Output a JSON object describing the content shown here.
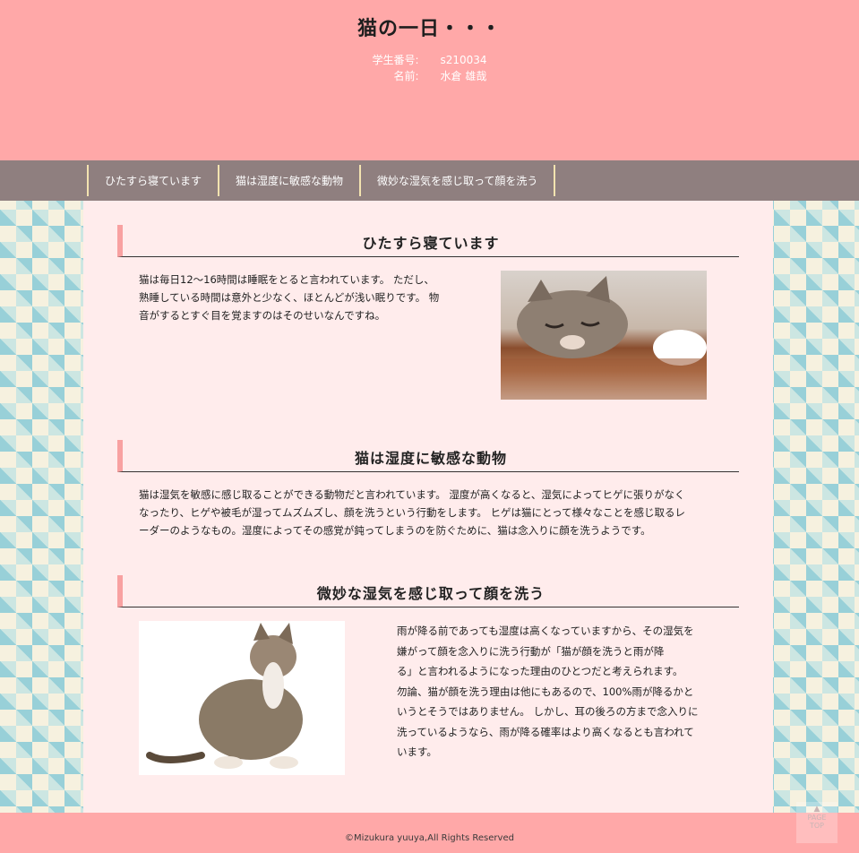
{
  "header": {
    "title": "猫の一日・・・",
    "student_id_label": "学生番号:",
    "student_id": "s210034",
    "name_label": "名前:",
    "name": "水倉 雄哉"
  },
  "nav": {
    "items": [
      {
        "label": "ひたすら寝ています"
      },
      {
        "label": "猫は湿度に敏感な動物"
      },
      {
        "label": "微妙な湿気を感じ取って顔を洗う"
      }
    ]
  },
  "sections": [
    {
      "heading": "ひたすら寝ています",
      "lines": [
        "猫は毎日12～16時間は睡眠をとると言われています。 ただし、",
        "熟睡している時間は意外と少なく、ほとんどが浅い眠りです。 物",
        "音がするとすぐ目を覚ますのはそのせいなんですね。"
      ]
    },
    {
      "heading": "猫は湿度に敏感な動物",
      "lines": [
        "猫は湿気を敏感に感じ取ることができる動物だと言われています。 湿度が高くなると、湿気によってヒゲに張りがなく",
        "なったり、ヒゲや被毛が湿ってムズムズし、顔を洗うという行動をします。 ヒゲは猫にとって様々なことを感じ取るレ",
        "ーダーのようなもの。湿度によってその感覚が鈍ってしまうのを防ぐために、猫は念入りに顔を洗うようです。"
      ]
    },
    {
      "heading": "微妙な湿気を感じ取って顔を洗う",
      "lines": [
        "雨が降る前であっても湿度は高くなっていますから、その湿気を",
        "嫌がって顔を念入りに洗う行動が「猫が顔を洗うと雨が降",
        "る」と言われるようになった理由のひとつだと考えられます。",
        "勿論、猫が顔を洗う理由は他にもあるので、100%雨が降るかと",
        "いうとそうではありません。 しかし、耳の後ろの方まで念入りに",
        "洗っているようなら、雨が降る確率はより高くなるとも言われて",
        "います。"
      ]
    }
  ],
  "footer": {
    "copyright": "©Mizukura yuuya,All Rights Reserved",
    "pagetop_line1": "PAGE",
    "pagetop_line2": "TOP"
  },
  "colors": {
    "header_bg": "#ffa8a8",
    "nav_bg": "#8f7f7f",
    "content_bg": "#ffecec",
    "accent": "#f8a1a1"
  }
}
